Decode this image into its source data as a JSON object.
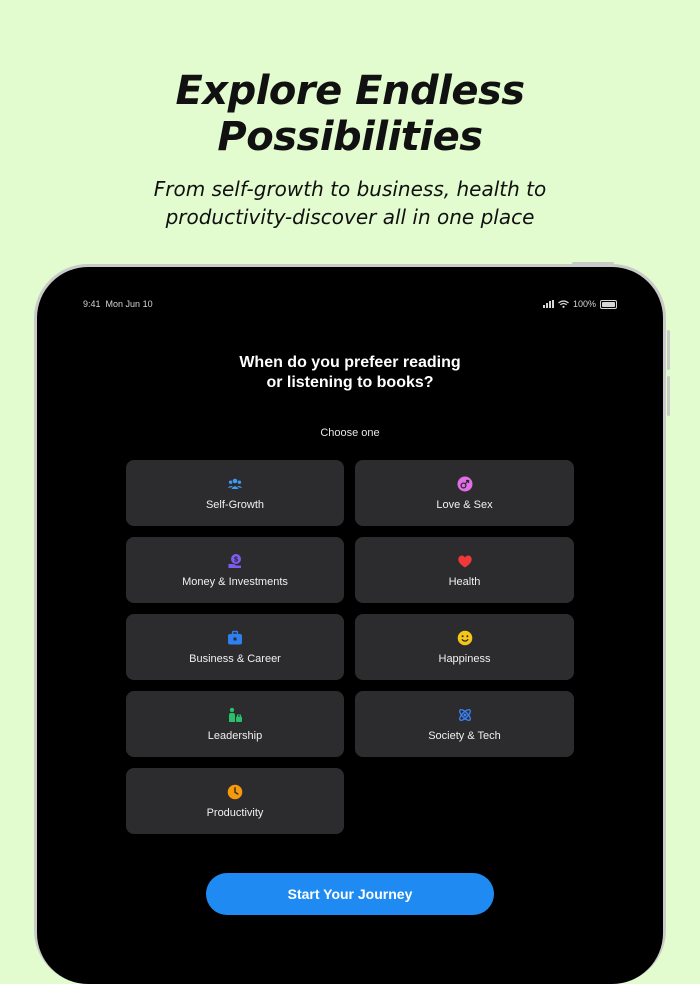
{
  "headline": {
    "line1": "Explore Endless",
    "line2": "Possibilities"
  },
  "subheadline": {
    "line1": "From self-growth to business, health to",
    "line2": "productivity-discover all in one place"
  },
  "status_bar": {
    "time": "9:41",
    "date": "Mon Jun 10",
    "battery": "100%"
  },
  "question": {
    "line1": "When do you prefeer reading",
    "line2": "or listening to books?"
  },
  "instruction": "Choose one",
  "categories": [
    {
      "label": "Self-Growth",
      "icon": "people-icon",
      "color": "#3b9cf5"
    },
    {
      "label": "Love & Sex",
      "icon": "love-icon",
      "color": "#e26de9"
    },
    {
      "label": "Money & Investments",
      "icon": "money-bag-icon",
      "color": "#7e5cf1"
    },
    {
      "label": "Health",
      "icon": "heart-icon",
      "color": "#f03838"
    },
    {
      "label": "Business & Career",
      "icon": "briefcase-icon",
      "color": "#2e7ff0"
    },
    {
      "label": "Happiness",
      "icon": "smiley-icon",
      "color": "#f5c518"
    },
    {
      "label": "Leadership",
      "icon": "leader-icon",
      "color": "#28c06a"
    },
    {
      "label": "Society & Tech",
      "icon": "atom-icon",
      "color": "#3b82f6"
    },
    {
      "label": "Productivity",
      "icon": "clock-icon",
      "color": "#f59a0c"
    }
  ],
  "cta_label": "Start Your Journey"
}
